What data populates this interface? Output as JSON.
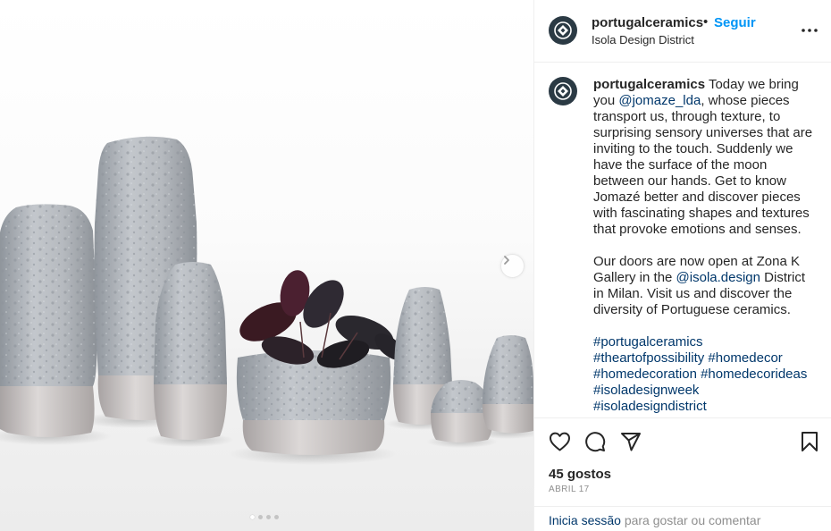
{
  "post": {
    "username": "portugalceramics",
    "separator": "•",
    "follow_label": "Seguir",
    "location": "Isola Design District",
    "more_label": "More options"
  },
  "caption": {
    "username": "portugalceramics",
    "p1_a": " Today we bring you ",
    "mention1": "@jomaze_lda",
    "p1_b": ", whose pieces transport us, through texture, to surprising sensory universes that are inviting to the touch. Suddenly we have the surface of the moon between our hands. Get to know Jomazé better and discover pieces with fascinating shapes and textures that provoke emotions and senses.",
    "p2_a": "Our doors are now open at Zona K Gallery in the ",
    "mention2": "@isola.design",
    "p2_b": " District in Milan. Visit us and discover the diversity of Portuguese ceramics.",
    "hashtags": [
      "#portugalceramics",
      "#theartofpossibility",
      "#homedecor",
      "#homedecoration",
      "#homedecorideas",
      "#isoladesignweek",
      "#isoladesigndistrict"
    ]
  },
  "actions": {
    "likes": "45 gostos",
    "date": "ABRIL 17"
  },
  "login": {
    "link": "Inicia sessão",
    "rest": " para gostar ou comentar"
  },
  "carousel": {
    "slide_count": 4,
    "active_index": 0
  },
  "colors": {
    "accent": "#0095f6",
    "link": "#00376b",
    "muted": "#8e8e8e",
    "avatar_bg": "#2b3a44"
  }
}
